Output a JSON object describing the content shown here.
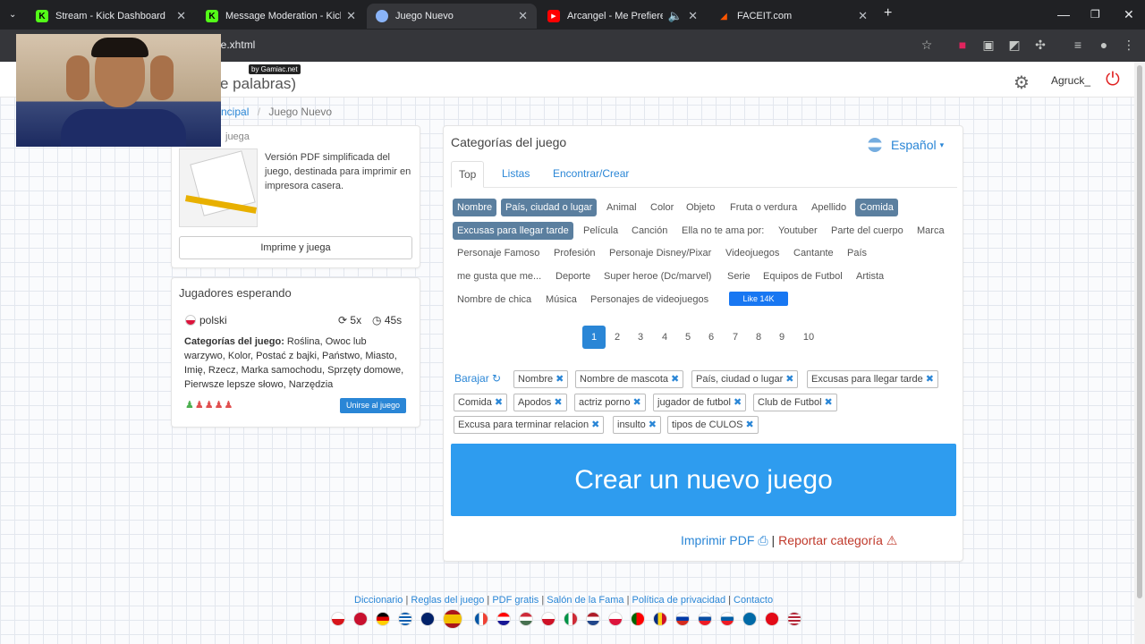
{
  "browser": {
    "tabs": [
      {
        "title": "Stream - Kick Dashboard",
        "icon": "kick-icon",
        "color": "#53fc18",
        "active": false
      },
      {
        "title": "Message Moderation - Kick Da",
        "icon": "kick-icon",
        "color": "#53fc18",
        "active": false
      },
      {
        "title": "Juego Nuevo",
        "icon": "site-icon",
        "color": "#8ab4f8",
        "active": true
      },
      {
        "title": "Arcangel - Me Prefieres a M",
        "icon": "youtube-icon",
        "color": "#ff0000",
        "active": false
      },
      {
        "title": "FACEIT.com",
        "icon": "faceit-icon",
        "color": "#ff5500",
        "active": false
      }
    ],
    "url": "ne.xhtml"
  },
  "header": {
    "title_fragment": "e palabras)",
    "byline": "by Gamiac.net",
    "username": "Agruck_"
  },
  "breadcrumb": {
    "parent": "ncipal",
    "current": "Juego Nuevo"
  },
  "pdf_panel": {
    "title_fragment": "juega",
    "description": "Versión PDF simplificada del juego, destinada para imprimir en impresora casera.",
    "button": "Imprime y juega"
  },
  "waiting_panel": {
    "title": "Jugadores esperando",
    "language": "polski",
    "rounds": "5x",
    "time": "45s",
    "categories_label": "Categorías del juego:",
    "categories_text": " Roślina, Owoc lub warzywo, Kolor, Postać z bajki, Państwo, Miasto, Imię, Rzecz, Marka samochodu, Sprzęty domowe, Pierwsze lepsze słowo, Narzędzia",
    "join_button": "Unirse al juego"
  },
  "main": {
    "title": "Categorías del juego",
    "language": "Español",
    "tabs": [
      "Top",
      "Listas",
      "Encontrar/Crear"
    ],
    "categories": [
      {
        "label": "Nombre",
        "selected": true
      },
      {
        "label": "País, ciudad o lugar",
        "selected": true
      },
      {
        "label": "Animal",
        "selected": false
      },
      {
        "label": "Color",
        "selected": false
      },
      {
        "label": "Objeto",
        "selected": false
      },
      {
        "label": "Fruta o verdura",
        "selected": false
      },
      {
        "label": "Apellido",
        "selected": false
      },
      {
        "label": "Comida",
        "selected": true
      },
      {
        "label": "Excusas para llegar tarde",
        "selected": true
      },
      {
        "label": "Película",
        "selected": false
      },
      {
        "label": "Canción",
        "selected": false
      },
      {
        "label": "Ella no te ama por:",
        "selected": false
      },
      {
        "label": "Youtuber",
        "selected": false
      },
      {
        "label": "Parte del cuerpo",
        "selected": false
      },
      {
        "label": "Marca",
        "selected": false
      },
      {
        "label": "Personaje Famoso",
        "selected": false
      },
      {
        "label": "Profesión",
        "selected": false
      },
      {
        "label": "Personaje Disney/Pixar",
        "selected": false
      },
      {
        "label": "Videojuegos",
        "selected": false
      },
      {
        "label": "Cantante",
        "selected": false
      },
      {
        "label": "País",
        "selected": false
      },
      {
        "label": "me gusta que me...",
        "selected": false
      },
      {
        "label": "Deporte",
        "selected": false
      },
      {
        "label": "Super heroe (Dc/marvel)",
        "selected": false
      },
      {
        "label": "Serie",
        "selected": false
      },
      {
        "label": "Equipos de Futbol",
        "selected": false
      },
      {
        "label": "Artista",
        "selected": false
      },
      {
        "label": "Nombre de chica",
        "selected": false
      },
      {
        "label": "Música",
        "selected": false
      },
      {
        "label": "Personajes de videojuegos",
        "selected": false
      }
    ],
    "like_button": "Like 14K",
    "pages": [
      "1",
      "2",
      "3",
      "4",
      "5",
      "6",
      "7",
      "8",
      "9",
      "10"
    ],
    "current_page": "1",
    "shuffle_label": "Barajar",
    "chosen": [
      "Nombre",
      "Nombre de mascota",
      "País, ciudad o lugar",
      "Excusas para llegar tarde",
      "Comida",
      "Apodos",
      "actriz porno",
      "jugador de futbol",
      "Club de Futbol",
      "Excusa para terminar relacion",
      "insulto",
      "tipos de CULOS"
    ],
    "create_button": "Crear un nuevo juego",
    "print_pdf": "Imprimir PDF",
    "separator": "|",
    "report": "Reportar categoría"
  },
  "footer": {
    "links": [
      "Diccionario",
      "Reglas del juego",
      "PDF gratis",
      "Salón de la Fama",
      "Política de privacidad",
      "Contacto"
    ],
    "separator": "|"
  },
  "colors": {
    "accent": "#2a86d6",
    "selected_category": "#5b7f9f",
    "create_button": "#2e9cef",
    "report": "#c0392b"
  }
}
